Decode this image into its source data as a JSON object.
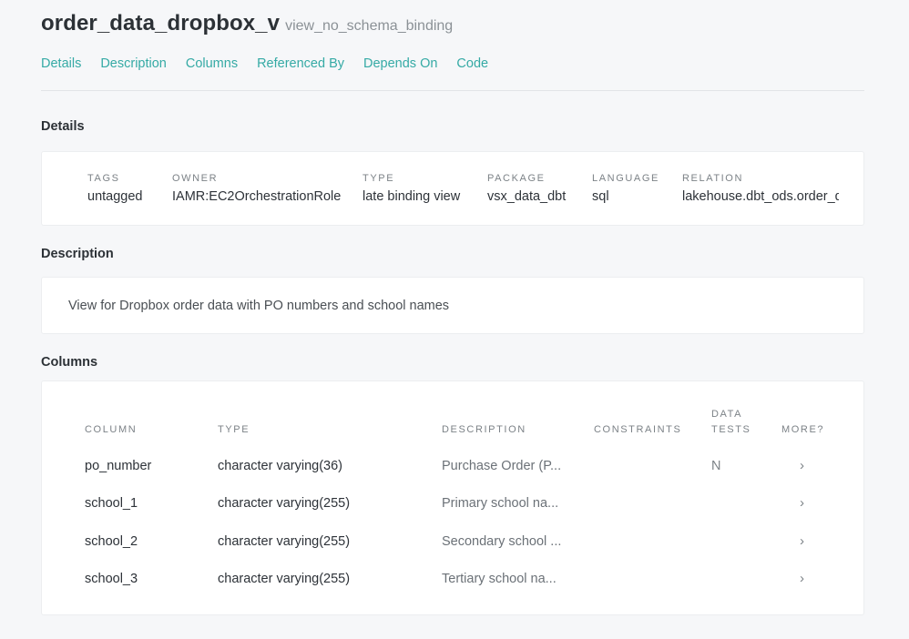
{
  "header": {
    "name": "order_data_dropbox_v",
    "type": "view_no_schema_binding"
  },
  "nav": [
    "Details",
    "Description",
    "Columns",
    "Referenced By",
    "Depends On",
    "Code"
  ],
  "sections": {
    "details": "Details",
    "description": "Description",
    "columns": "Columns"
  },
  "details": [
    {
      "label": "TAGS",
      "value": "untagged"
    },
    {
      "label": "OWNER",
      "value": "IAMR:EC2OrchestrationRole"
    },
    {
      "label": "TYPE",
      "value": "late binding view"
    },
    {
      "label": "PACKAGE",
      "value": "vsx_data_dbt"
    },
    {
      "label": "LANGUAGE",
      "value": "sql"
    },
    {
      "label": "RELATION",
      "value": "lakehouse.dbt_ods.order_data_dropbox_v"
    }
  ],
  "description": "View for Dropbox order data with PO numbers and school names",
  "columns_table": {
    "headers": {
      "column": "COLUMN",
      "type": "TYPE",
      "description": "DESCRIPTION",
      "constraints": "CONSTRAINTS",
      "data_tests_1": "DATA",
      "data_tests_2": "TESTS",
      "more": "MORE?"
    },
    "rows": [
      {
        "name": "po_number",
        "type": "character varying(36)",
        "description": "Purchase Order (P...",
        "tests": "N",
        "more": "›"
      },
      {
        "name": "school_1",
        "type": "character varying(255)",
        "description": "Primary school na...",
        "tests": "",
        "more": "›"
      },
      {
        "name": "school_2",
        "type": "character varying(255)",
        "description": "Secondary school ...",
        "tests": "",
        "more": "›"
      },
      {
        "name": "school_3",
        "type": "character varying(255)",
        "description": "Tertiary school na...",
        "tests": "",
        "more": "›"
      }
    ]
  }
}
